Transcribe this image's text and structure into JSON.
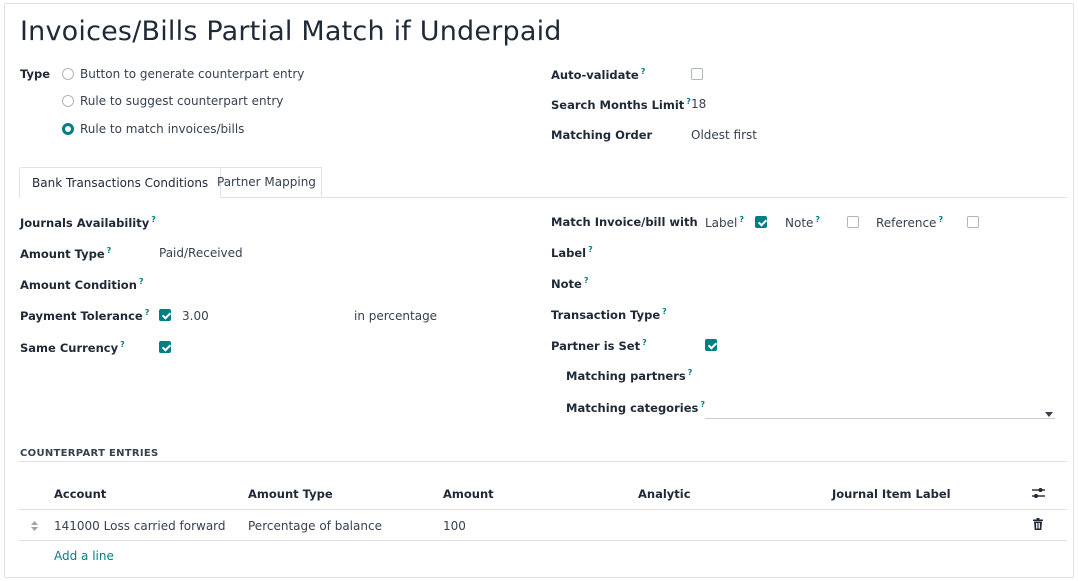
{
  "record": {
    "title": "Invoices/Bills Partial Match if Underpaid"
  },
  "type_field": {
    "label": "Type",
    "options": [
      {
        "label": "Button to generate counterpart entry",
        "selected": false
      },
      {
        "label": "Rule to suggest counterpart entry",
        "selected": false
      },
      {
        "label": "Rule to match invoices/bills",
        "selected": true
      }
    ]
  },
  "right_fields": {
    "auto_validate_label": "Auto-validate",
    "auto_validate_checked": false,
    "search_months_label": "Search Months Limit",
    "search_months_value": "18",
    "matching_order_label": "Matching Order",
    "matching_order_value": "Oldest first"
  },
  "tabs": [
    {
      "label": "Bank Transactions Conditions",
      "active": true
    },
    {
      "label": "Partner Mapping",
      "active": false
    }
  ],
  "conditions": {
    "journals_label": "Journals Availability",
    "amount_type_label": "Amount Type",
    "amount_type_value": "Paid/Received",
    "amount_condition_label": "Amount Condition",
    "payment_tolerance_label": "Payment Tolerance",
    "payment_tolerance_checked": true,
    "payment_tolerance_value": "3.00",
    "payment_tolerance_unit": "in percentage",
    "same_currency_label": "Same Currency",
    "same_currency_checked": true,
    "match_with_label": "Match Invoice/bill with",
    "match_label_option": "Label",
    "match_label_checked": true,
    "match_note_option": "Note",
    "match_note_checked": false,
    "match_reference_option": "Reference",
    "match_reference_checked": false,
    "label_label": "Label",
    "note_label": "Note",
    "transaction_type_label": "Transaction Type",
    "partner_set_label": "Partner is Set",
    "partner_set_checked": true,
    "matching_partners_label": "Matching partners",
    "matching_categories_label": "Matching categories",
    "help_mark": "?"
  },
  "counterpart": {
    "section_title": "COUNTERPART ENTRIES",
    "columns": [
      "Account",
      "Amount Type",
      "Amount",
      "Analytic",
      "Journal Item Label"
    ],
    "rows": [
      {
        "account": "141000 Loss carried forward",
        "amount_type": "Percentage of balance",
        "amount": "100",
        "analytic": "",
        "label": ""
      }
    ],
    "add_line": "Add a line"
  },
  "icons": {
    "settings": "sliders-icon",
    "delete": "trash-icon",
    "drag": "drag-handle-icon",
    "dropdown": "caret-down-icon"
  },
  "colors": {
    "accent": "#017e84",
    "border": "#dee2e6",
    "text": "#374151"
  }
}
